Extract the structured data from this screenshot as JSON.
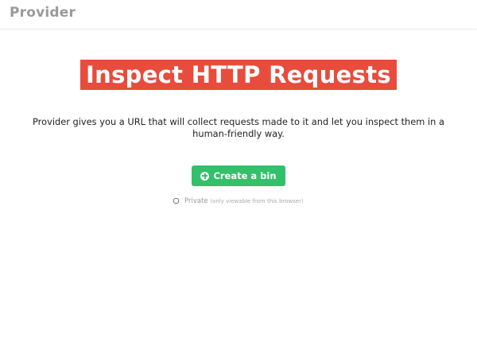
{
  "header": {
    "brand": "Provider"
  },
  "hero": {
    "title": "Inspect HTTP Requests",
    "description": "Provider gives you a URL that will collect requests made to it and let you inspect them in a human-friendly way."
  },
  "actions": {
    "create_label": "Create a bin",
    "create_icon": "plus-circle-icon"
  },
  "options": {
    "private_label": "Private",
    "private_note": "(only viewable from this browser)",
    "private_checked": false
  },
  "colors": {
    "hero_bg": "#e74c3c",
    "button_bg": "#33c06a",
    "brand": "#9a9a9a"
  }
}
